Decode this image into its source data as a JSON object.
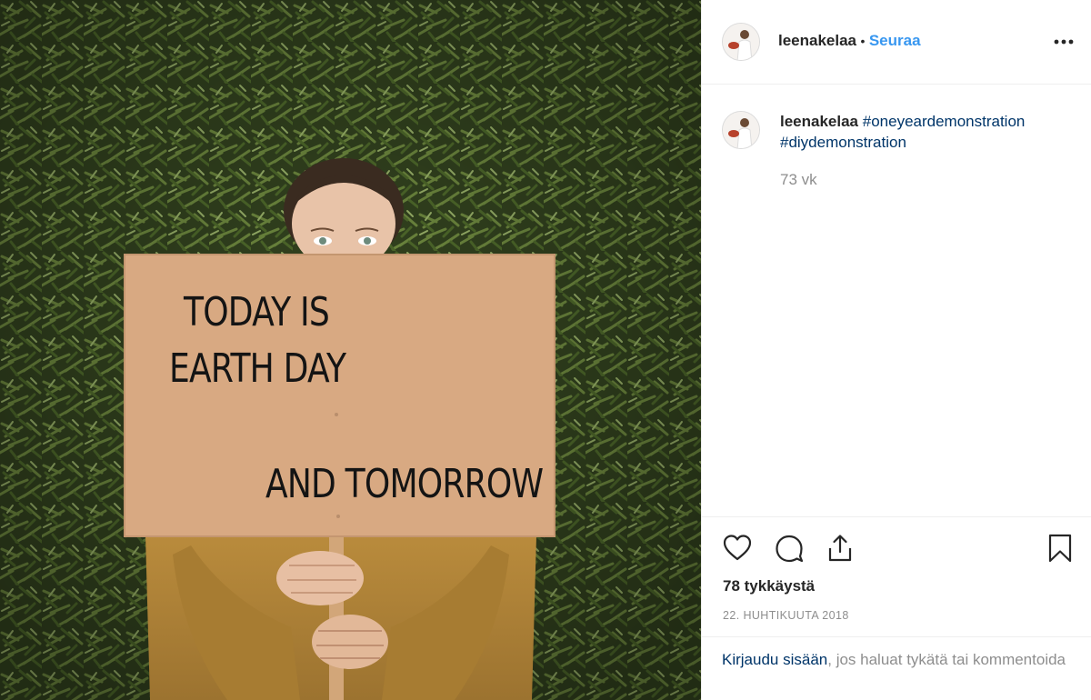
{
  "post": {
    "image": {
      "alt_icon": "photo",
      "sign_line_1": "TODAY IS",
      "sign_line_2": "EARTH DAY",
      "sign_line_3": "AND TOMORROW"
    },
    "author": {
      "username": "leenakelaa",
      "separator": "•",
      "follow_label": "Seuraa",
      "more_icon": "more-horizontal-icon"
    },
    "caption": {
      "username": "leenakelaa",
      "hashtag_1": "#oneyeardemonstration",
      "hashtag_2": "#diydemonstration",
      "time_ago": "73 vk"
    },
    "actions": {
      "like_icon": "heart-icon",
      "comment_icon": "comment-icon",
      "share_icon": "share-icon",
      "save_icon": "bookmark-icon"
    },
    "likes_text": "78 tykkäystä",
    "date_text": "22. HUHTIKUUTA 2018",
    "login": {
      "link_text": "Kirjaudu sisään",
      "rest_text": ", jos haluat tykätä tai kommentoida"
    }
  },
  "colors": {
    "link_blue": "#3897f0",
    "hashtag_blue": "#003569",
    "muted_gray": "#8e8e8e",
    "border": "#efefef"
  }
}
